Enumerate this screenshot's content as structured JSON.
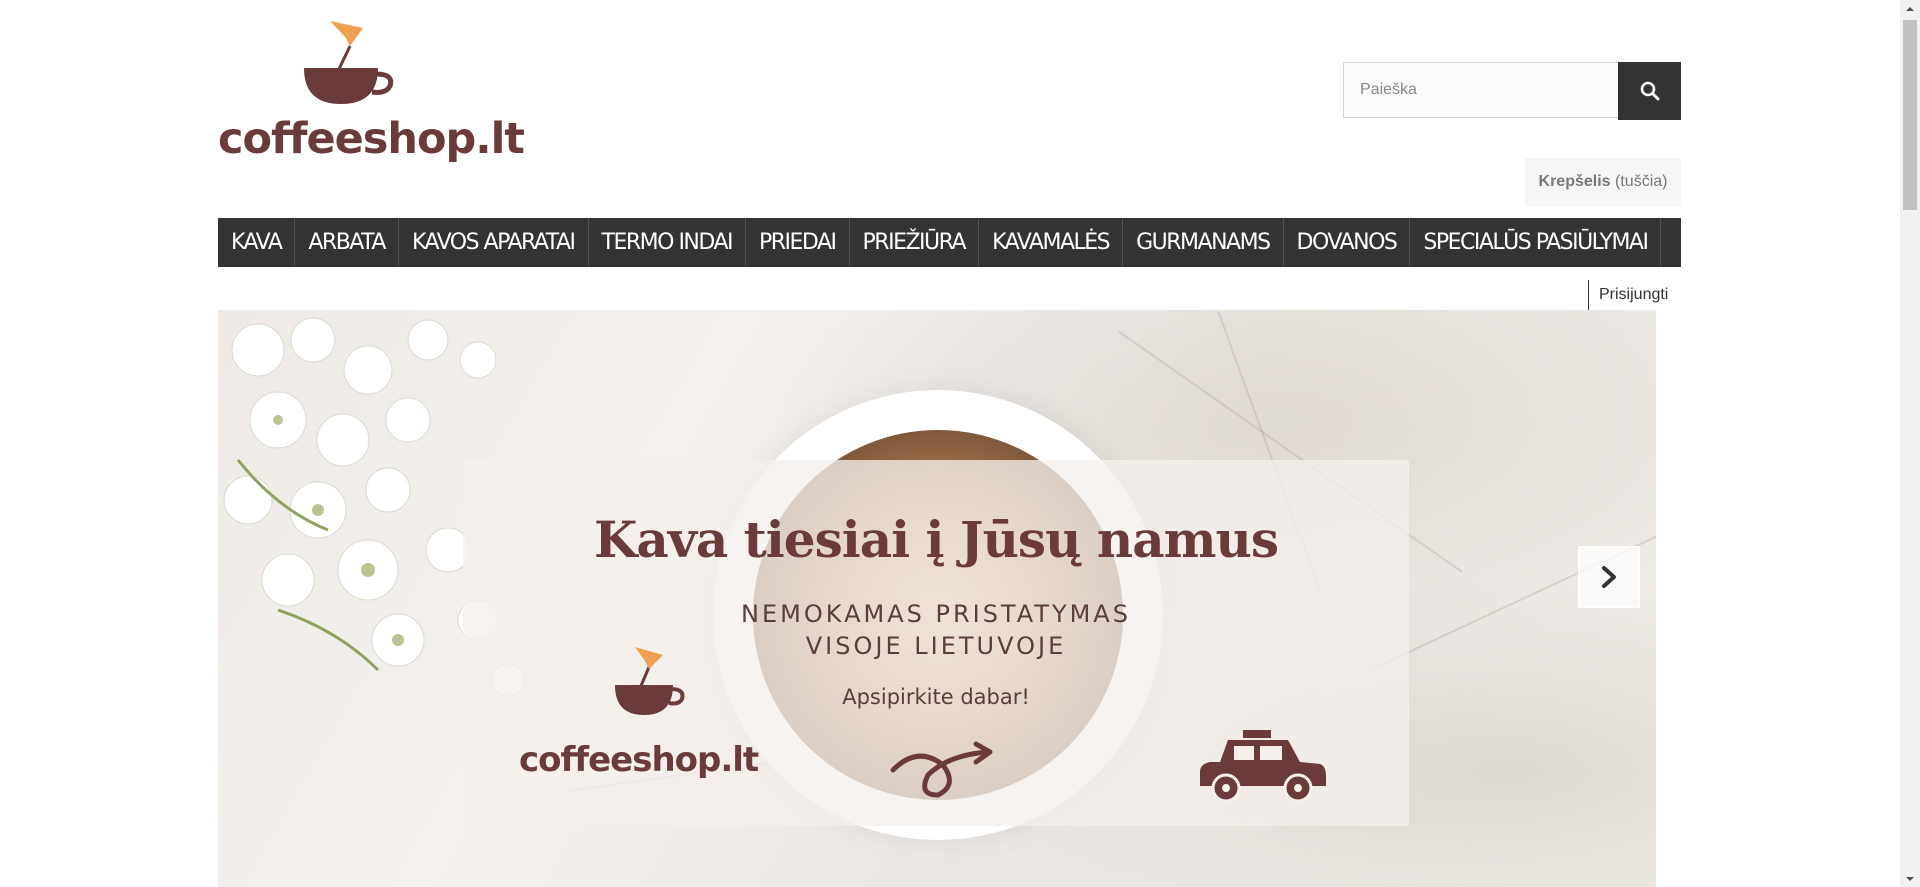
{
  "header": {
    "logo_text": "coffeeshop.lt"
  },
  "search": {
    "placeholder": "Paieška"
  },
  "cart": {
    "label": "Krepšelis",
    "status": "(tuščia)"
  },
  "nav": {
    "items": [
      {
        "label": "KAVA"
      },
      {
        "label": "ARBATA"
      },
      {
        "label": "KAVOS APARATAI"
      },
      {
        "label": "TERMO INDAI"
      },
      {
        "label": "PRIEDAI"
      },
      {
        "label": "PRIEŽIŪRA"
      },
      {
        "label": "KAVAMALĖS"
      },
      {
        "label": "GURMANAMS"
      },
      {
        "label": "DOVANOS"
      },
      {
        "label": "SPECIALŪS PASIŪLYMAI"
      }
    ]
  },
  "user": {
    "login_label": "Prisijungti"
  },
  "banner": {
    "headline": "Kava tiesiai į Jūsų namus",
    "subline_1": "NEMOKAMAS PRISTATYMAS",
    "subline_2": "VISOJE LIETUVOJE",
    "cta": "Apsipirkite dabar!",
    "logo_text": "coffeeshop.lt"
  },
  "colors": {
    "brand": "#6b3a3a",
    "accent": "#f0a050",
    "nav_bg": "#333333"
  },
  "icons": {
    "search": "search-icon",
    "next": "chevron-right-icon",
    "car": "car-icon"
  }
}
